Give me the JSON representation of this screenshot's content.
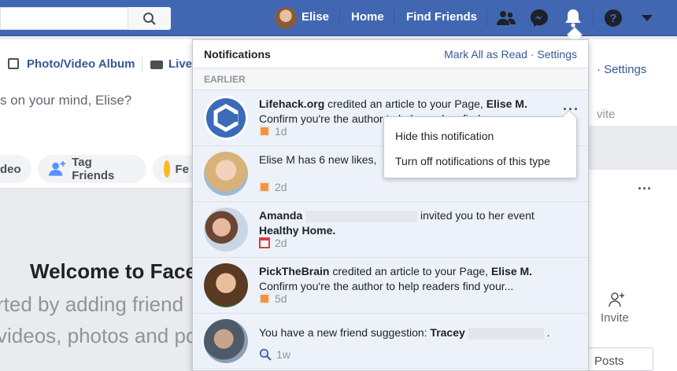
{
  "colors": {
    "brand": "#4267b2",
    "link": "#365899",
    "unread_bg": "#edf2fa"
  },
  "topbar": {
    "user_name": "Elise",
    "home": "Home",
    "find_friends": "Find Friends"
  },
  "left": {
    "photo_video": "Photo/Video Album",
    "live": "Live",
    "composer_placeholder": "s on your mind, Elise?",
    "video_pill": "deo",
    "tag_friends": "Tag Friends",
    "feeling_pill": "Fe",
    "welcome": "Welcome to Face",
    "welcome_line1": "rted by adding friend",
    "welcome_line2": "videos, photos and po"
  },
  "right": {
    "settings": "· Settings",
    "invite_top": "vite",
    "invite": "Invite",
    "posts": "Posts"
  },
  "dropdown": {
    "title": "Notifications",
    "mark_all": "Mark All as Read",
    "settings": "Settings",
    "section": "EARLIER",
    "items": [
      {
        "a": "Lifehack.org",
        "t1": " credited an article to your Page, ",
        "b": "Elise M.",
        "line2": "Confirm you're the author to help readers find your...",
        "time": "1d"
      },
      {
        "a": "Elise M",
        "t1": " has 6 new likes, ",
        "time": "2d"
      },
      {
        "a": "Amanda",
        "t1": " invited you to her event",
        "b2": "Healthy Home.",
        "time": "2d"
      },
      {
        "a": "PickTheBrain",
        "t1": " credited an article to your Page, ",
        "b": "Elise M.",
        "line2": "Confirm you're the author to help readers find your...",
        "time": "5d"
      },
      {
        "t0": "You have a new friend suggestion: ",
        "b": "Tracey",
        "t2": " .",
        "time": "1w"
      }
    ],
    "context_menu": [
      "Hide this notification",
      "Turn off notifications of this type"
    ]
  }
}
